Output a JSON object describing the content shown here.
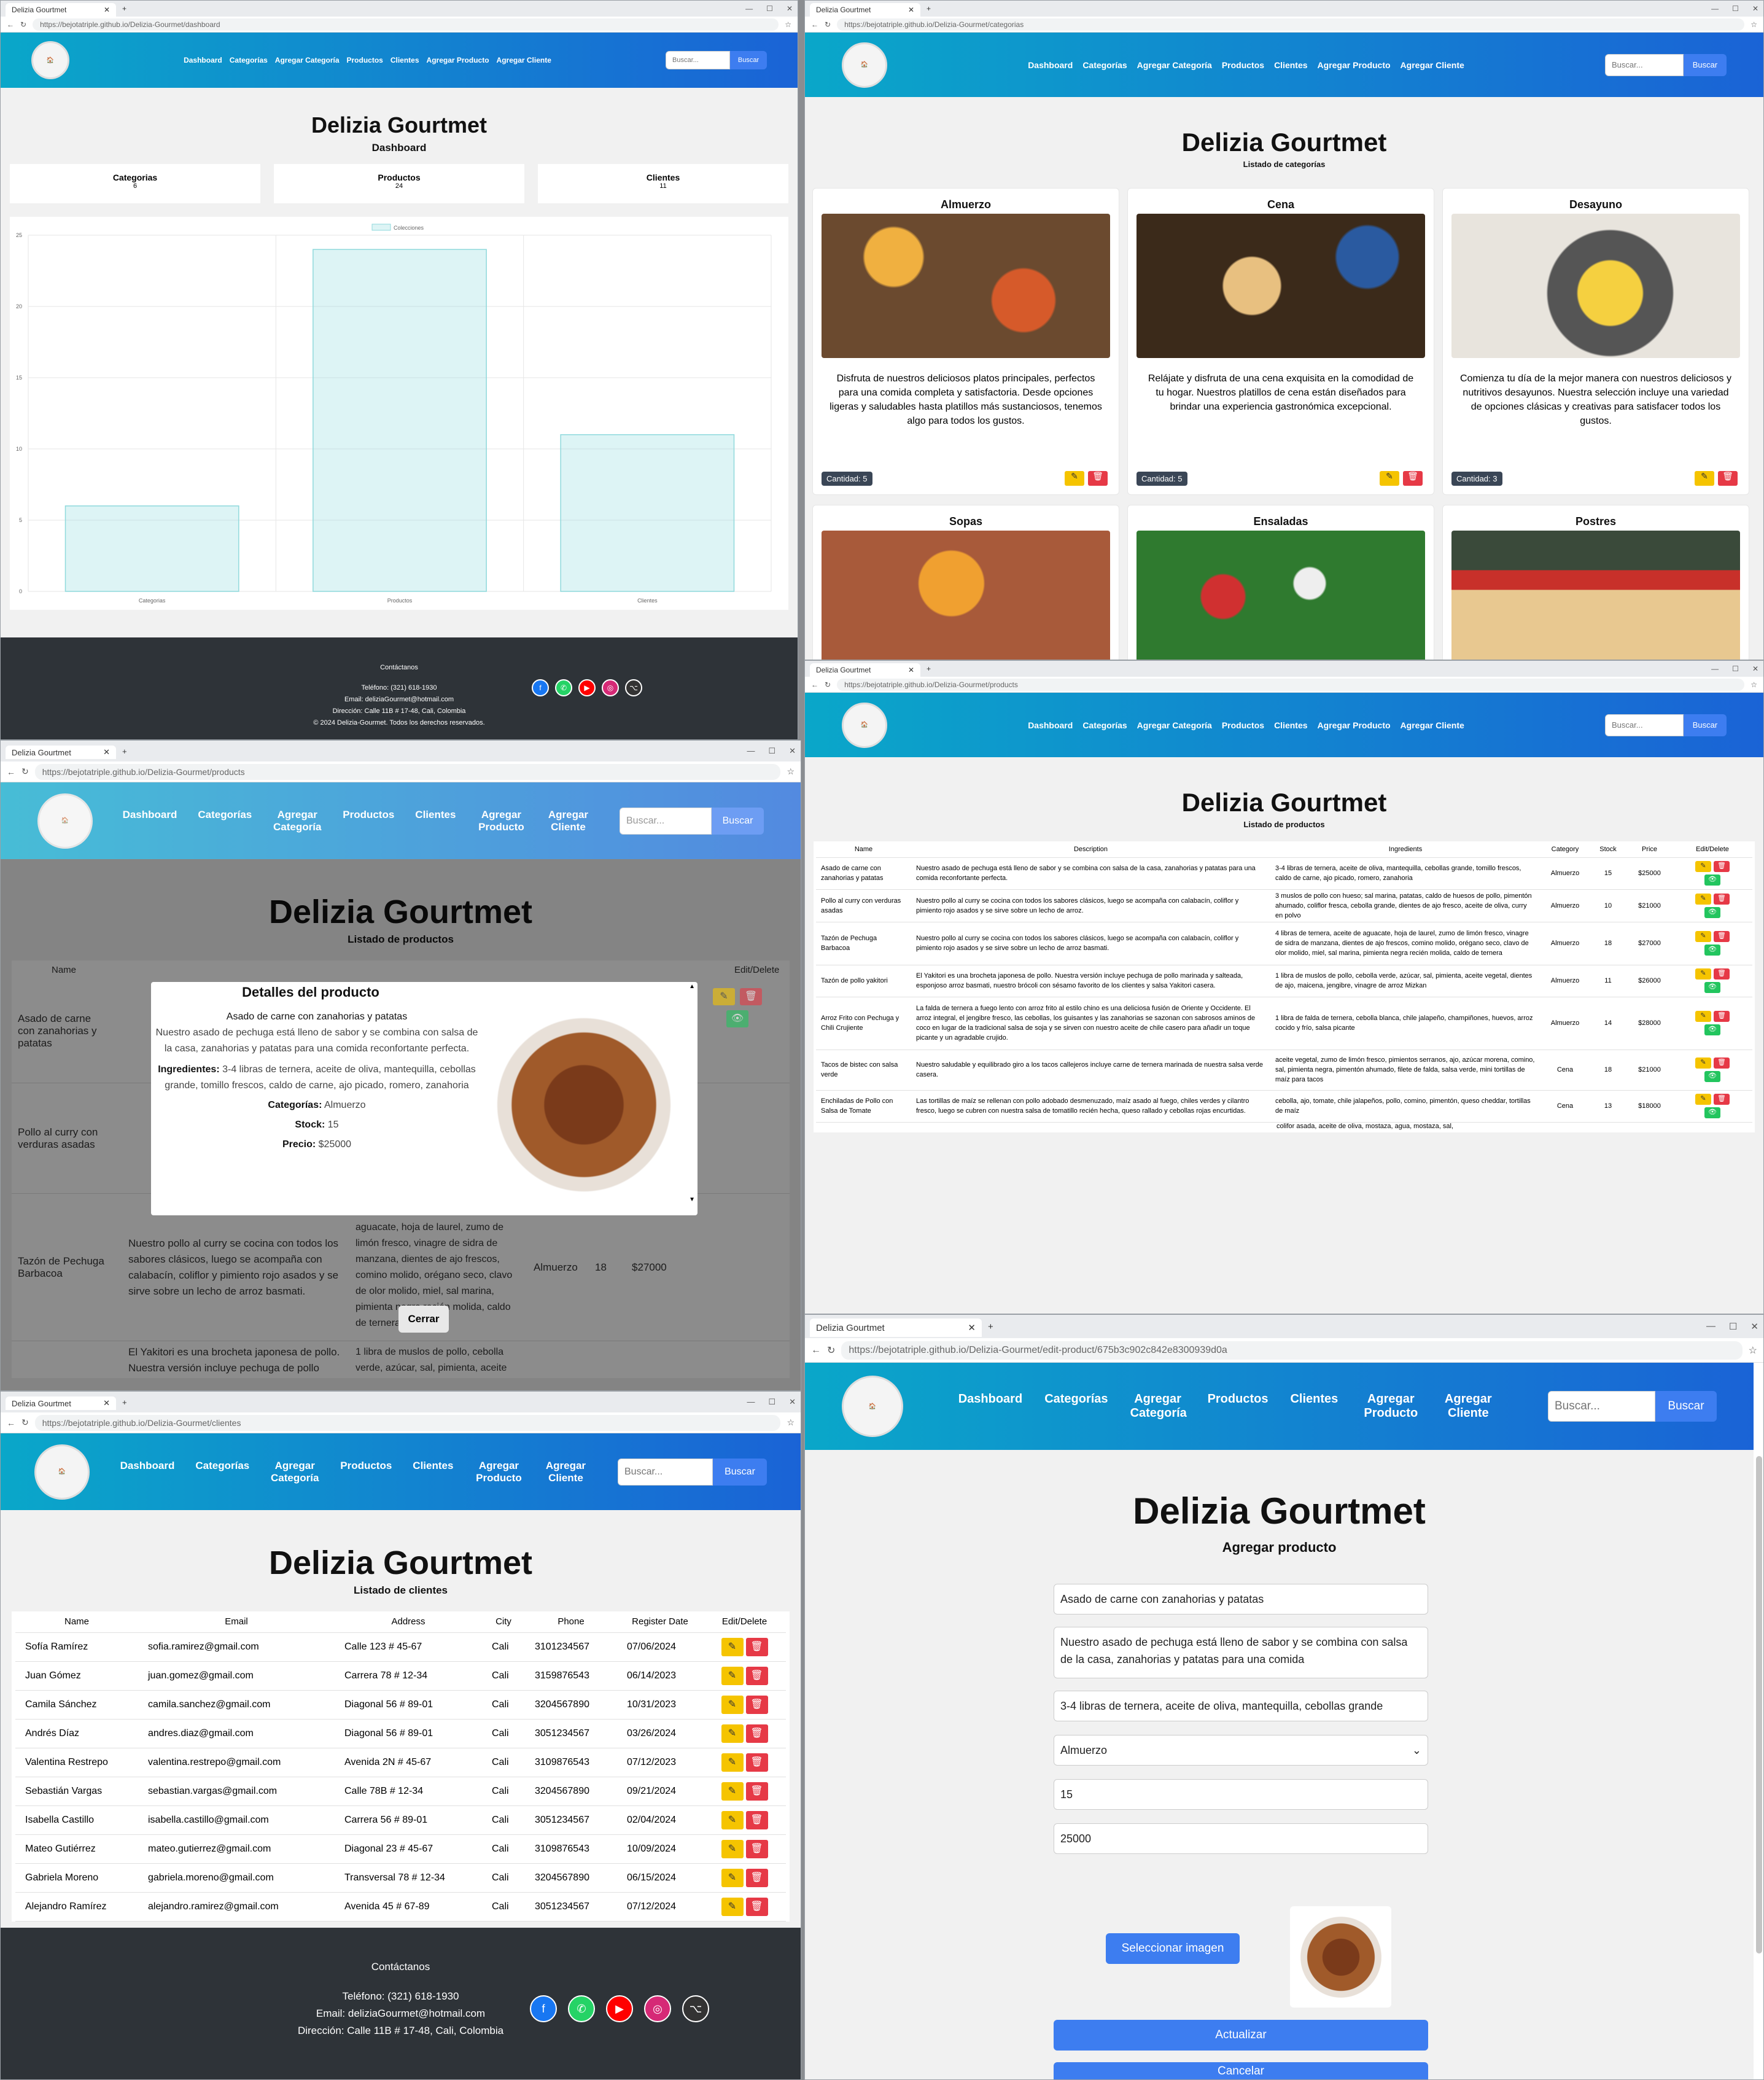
{
  "brand": "Delizia Gourtmet",
  "tab_title": "Delizia Gourtmet",
  "nav": {
    "dashboard": "Dashboard",
    "categorias": "Categorías",
    "agregar_categoria": "Agregar Categoría",
    "productos": "Productos",
    "clientes": "Clientes",
    "agregar_producto": "Agregar Producto",
    "agregar_cliente": "Agregar Cliente",
    "search_placeholder": "Buscar...",
    "search_button": "Buscar"
  },
  "urls": {
    "dashboard": "https://bejotatriple.github.io/Delizia-Gourmet/dashboard",
    "categorias": "https://bejotatriple.github.io/Delizia-Gourmet/categorias",
    "products": "https://bejotatriple.github.io/Delizia-Gourmet/products",
    "clientes": "https://bejotatriple.github.io/Delizia-Gourmet/clientes",
    "edit": "https://bejotatriple.github.io/Delizia-Gourmet/edit-product/675b3c902c842e8300939d0a"
  },
  "dashboard": {
    "subtitle": "Dashboard",
    "stats": [
      {
        "label": "Categorias",
        "value": "6"
      },
      {
        "label": "Productos",
        "value": "24"
      },
      {
        "label": "Clientes",
        "value": "11"
      }
    ]
  },
  "chart_data": {
    "type": "bar",
    "categories": [
      "Categorias",
      "Productos",
      "Clientes"
    ],
    "values": [
      6,
      24,
      11
    ],
    "series_name": "Colecciones",
    "ylim": [
      0,
      25
    ],
    "yticks": [
      "0",
      "5",
      "10",
      "15",
      "20",
      "25"
    ],
    "legend": "top"
  },
  "footer": {
    "title": "Contáctanos",
    "phone": "Teléfono: (321) 618-1930",
    "email": "Email: deliziaGourmet@hotmail.com",
    "address": "Dirección: Calle 11B # 17-48, Cali, Colombia",
    "copyright": "© 2024 Delizia-Gourmet. Todos los derechos reservados."
  },
  "categorias": {
    "subtitle": "Listado de categorías",
    "items": [
      {
        "name": "Almuerzo",
        "desc": "Disfruta de nuestros deliciosos platos principales, perfectos para una comida completa y satisfactoria. Desde opciones ligeras y saludables hasta platillos más sustanciosos, tenemos algo para todos los gustos.",
        "count": "Cantidad: 5"
      },
      {
        "name": "Cena",
        "desc": "Relájate y disfruta de una cena exquisita en la comodidad de tu hogar. Nuestros platillos de cena están diseñados para brindar una experiencia gastronómica excepcional.",
        "count": "Cantidad: 5"
      },
      {
        "name": "Desayuno",
        "desc": "Comienza tu día de la mejor manera con nuestros deliciosos y nutritivos desayunos. Nuestra selección incluye una variedad de opciones clásicas y creativas para satisfacer todos los gustos.",
        "count": "Cantidad: 3"
      },
      {
        "name": "Sopas"
      },
      {
        "name": "Ensaladas"
      },
      {
        "name": "Postres"
      }
    ]
  },
  "productos": {
    "subtitle": "Listado de productos",
    "headers": [
      "Name",
      "Description",
      "Ingredients",
      "Category",
      "Stock",
      "Price",
      "Edit/Delete"
    ],
    "rows": [
      [
        "Asado de carne con zanahorias y patatas",
        "Nuestro asado de pechuga está lleno de sabor y se combina con salsa de la casa, zanahorias y patatas para una comida reconfortante perfecta.",
        "3-4 libras de ternera, aceite de oliva, mantequilla, cebollas grande, tomillo frescos, caldo de carne, ajo picado, romero, zanahoria",
        "Almuerzo",
        "15",
        "$25000"
      ],
      [
        "Pollo al curry con verduras asadas",
        "Nuestro pollo al curry se cocina con todos los sabores clásicos, luego se acompaña con calabacín, coliflor y pimiento rojo asados y se sirve sobre un lecho de arroz.",
        "3 muslos de pollo con hueso; sal marina, patatas, caldo de huesos de pollo, pimentón ahumado, coliflor fresca, cebolla grande, dientes de ajo fresco, aceite de oliva, curry en polvo",
        "Almuerzo",
        "10",
        "$21000"
      ],
      [
        "Tazón de Pechuga Barbacoa",
        "Nuestro pollo al curry se cocina con todos los sabores clásicos, luego se acompaña con calabacín, coliflor y pimiento rojo asados y se sirve sobre un lecho de arroz basmati.",
        "4 libras de ternera, aceite de aguacate, hoja de laurel, zumo de limón fresco, vinagre de sidra de manzana, dientes de ajo frescos, comino molido, orégano seco, clavo de olor molido, miel, sal marina, pimienta negra recién molida, caldo de ternera",
        "Almuerzo",
        "18",
        "$27000"
      ],
      [
        "Tazón de pollo yakitori",
        "El Yakitori es una brocheta japonesa de pollo. Nuestra versión incluye pechuga de pollo marinada y salteada, esponjoso arroz basmati, nuestro brócoli con sésamo favorito de los clientes y salsa Yakitori casera.",
        "1 libra de muslos de pollo, cebolla verde, azúcar, sal, pimienta, aceite vegetal, dientes de ajo, maicena, jengibre, vinagre de arroz Mizkan",
        "Almuerzo",
        "11",
        "$26000"
      ],
      [
        "Arroz Frito con Pechuga y Chili Crujiente",
        "La falda de ternera a fuego lento con arroz frito al estilo chino es una deliciosa fusión de Oriente y Occidente. El arroz integral, el jengibre fresco, las cebollas, los guisantes y las zanahorias se sazonan con sabrosos aminos de coco en lugar de la tradicional salsa de soja y se sirven con nuestro aceite de chile casero para añadir un toque picante y un agradable crujido.",
        "1 libra de falda de ternera, cebolla blanca, chile jalapeño, champiñones, huevos, arroz cocido y frío, salsa picante",
        "Almuerzo",
        "14",
        "$28000"
      ],
      [
        "Tacos de bistec con salsa verde",
        "Nuestro saludable y equilibrado giro a los tacos callejeros incluye carne de ternera marinada de nuestra salsa verde casera.",
        "aceite vegetal, zumo de limón fresco, pimientos serranos, ajo, azúcar morena, comino, sal, pimienta negra, pimentón ahumado, filete de falda, salsa verde, mini tortillas de maíz para tacos",
        "Cena",
        "18",
        "$21000"
      ],
      [
        "Enchiladas de Pollo con Salsa de Tomate",
        "Las tortillas de maíz se rellenan con pollo adobado desmenuzado, maíz asado al fuego, chiles verdes y cilantro fresco, luego se cubren con nuestra salsa de tomatillo recién hecha, queso rallado y cebollas rojas encurtidas.",
        "cebolla, ajo, tomate, chile jalapeños, pollo, comino, pimentón, queso cheddar, tortillas de maíz",
        "Cena",
        "13",
        "$18000"
      ]
    ],
    "partial_ing": "colifor asada, aceite de oliva, mostaza, agua, mostaza, sal,"
  },
  "modal": {
    "title": "Detalles del producto",
    "name": "Asado de carne con zanahorias y patatas",
    "desc": "Nuestro asado de pechuga está lleno de sabor y se combina con salsa de la casa, zanahorias y patatas para una comida reconfortante perfecta.",
    "ing_label": "Ingredientes:",
    "ing": "3-4 libras de ternera, aceite de oliva, mantequilla, cebollas grande, tomillo frescos, caldo de carne, ajo picado, romero, zanahoria",
    "cat_label": "Categorías:",
    "cat": "Almuerzo",
    "stock_label": "Stock:",
    "stock": "15",
    "price_label": "Precio:",
    "price": "$25000",
    "close": "Cerrar"
  },
  "clientes": {
    "subtitle": "Listado de clientes",
    "headers": [
      "Name",
      "Email",
      "Address",
      "City",
      "Phone",
      "Register Date",
      "Edit/Delete"
    ],
    "rows": [
      [
        "Sofía Ramírez",
        "sofia.ramirez@gmail.com",
        "Calle 123 # 45-67",
        "Cali",
        "3101234567",
        "07/06/2024"
      ],
      [
        "Juan Gómez",
        "juan.gomez@gmail.com",
        "Carrera 78 # 12-34",
        "Cali",
        "3159876543",
        "06/14/2023"
      ],
      [
        "Camila Sánchez",
        "camila.sanchez@gmail.com",
        "Diagonal 56 # 89-01",
        "Cali",
        "3204567890",
        "10/31/2023"
      ],
      [
        "Andrés Díaz",
        "andres.diaz@gmail.com",
        "Diagonal 56 # 89-01",
        "Cali",
        "3051234567",
        "03/26/2024"
      ],
      [
        "Valentina Restrepo",
        "valentina.restrepo@gmail.com",
        "Avenida 2N # 45-67",
        "Cali",
        "3109876543",
        "07/12/2023"
      ],
      [
        "Sebastián Vargas",
        "sebastian.vargas@gmail.com",
        "Calle 78B # 12-34",
        "Cali",
        "3204567890",
        "09/21/2024"
      ],
      [
        "Isabella Castillo",
        "isabella.castillo@gmail.com",
        "Carrera 56 # 89-01",
        "Cali",
        "3051234567",
        "02/04/2024"
      ],
      [
        "Mateo Gutiérrez",
        "mateo.gutierrez@gmail.com",
        "Diagonal 23 # 45-67",
        "Cali",
        "3109876543",
        "10/09/2024"
      ],
      [
        "Gabriela Moreno",
        "gabriela.moreno@gmail.com",
        "Transversal 78 # 12-34",
        "Cali",
        "3204567890",
        "06/15/2024"
      ],
      [
        "Alejandro Ramírez",
        "alejandro.ramirez@gmail.com",
        "Avenida 45 # 67-89",
        "Cali",
        "3051234567",
        "07/12/2024"
      ]
    ]
  },
  "edit": {
    "subtitle": "Agregar producto",
    "name": "Asado de carne con zanahorias y patatas",
    "desc": "Nuestro asado de pechuga está lleno de sabor y se combina con salsa de la casa, zanahorias y patatas para una comida",
    "ing": "3-4 libras de ternera, aceite de oliva, mantequilla, cebollas grande",
    "cat": "Almuerzo",
    "stock": "15",
    "price": "25000",
    "select_image": "Seleccionar imagen",
    "update": "Actualizar",
    "cancel": "Cancelar"
  }
}
